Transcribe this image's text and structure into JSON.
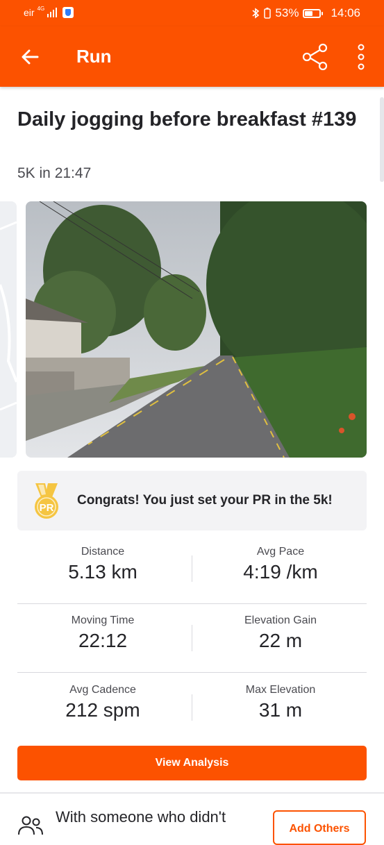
{
  "status_bar": {
    "carrier": "eir",
    "network": "4G",
    "bluetooth_icon": "bluetooth-icon",
    "battery_percent": "53%",
    "battery_level": 0.53,
    "time": "14:06"
  },
  "app_bar": {
    "back_icon": "arrow-left-icon",
    "title": "Run",
    "share_icon": "share-icon",
    "more_icon": "more-vertical-icon"
  },
  "activity": {
    "title": "Daily jogging before breakfast #139",
    "subtitle": "5K in 21:47"
  },
  "pr_banner": {
    "medal_text": "PR",
    "text": "Congrats! You just set your PR in the 5k!"
  },
  "stats": [
    {
      "label": "Distance",
      "value": "5.13 km"
    },
    {
      "label": "Avg Pace",
      "value": "4:19 /km"
    },
    {
      "label": "Moving Time",
      "value": "22:12"
    },
    {
      "label": "Elevation Gain",
      "value": "22 m"
    },
    {
      "label": "Avg Cadence",
      "value": "212 spm"
    },
    {
      "label": "Max Elevation",
      "value": "31 m"
    }
  ],
  "actions": {
    "view_analysis": "View Analysis",
    "with_others_text": "With someone who didn't",
    "add_others": "Add Others"
  },
  "colors": {
    "brand": "#fc5200",
    "text": "#242428",
    "secondary_text": "#4a4a50",
    "banner_bg": "#f3f3f5",
    "medal": "#f5c542"
  }
}
